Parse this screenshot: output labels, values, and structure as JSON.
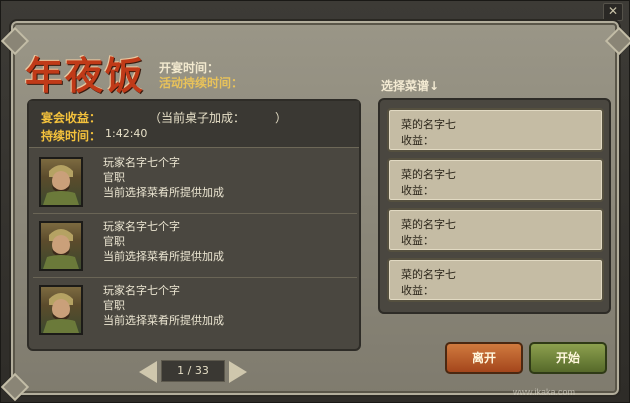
{
  "header": {
    "title": "年夜饭",
    "open_time_label": "开宴时间：",
    "duration_label": "活动持续时间："
  },
  "banquet": {
    "income_label": "宴会收益：",
    "bonus_label": "（当前桌子加成：",
    "bonus_close": "）",
    "time_label": "持续时间：",
    "time_value": "1:42:40"
  },
  "players": [
    {
      "name": "玩家名字七个字",
      "rank": "官职",
      "note": "当前选择菜肴所提供加成"
    },
    {
      "name": "玩家名字七个字",
      "rank": "官职",
      "note": "当前选择菜肴所提供加成"
    },
    {
      "name": "玩家名字七个字",
      "rank": "官职",
      "note": "当前选择菜肴所提供加成"
    }
  ],
  "pager": {
    "text": "1 / 33"
  },
  "menu": {
    "header": "选择菜谱↓",
    "dishes": [
      {
        "name": "菜的名字七",
        "income": "收益："
      },
      {
        "name": "菜的名字七",
        "income": "收益："
      },
      {
        "name": "菜的名字七",
        "income": "收益："
      },
      {
        "name": "菜的名字七",
        "income": "收益："
      }
    ]
  },
  "buttons": {
    "leave": "离开",
    "start": "开始"
  },
  "watermark": "www.ikaka.com",
  "colors": {
    "title": "#c03a18",
    "highlight": "#f4c23c",
    "leave": "#b8562a",
    "start": "#6f8438"
  }
}
